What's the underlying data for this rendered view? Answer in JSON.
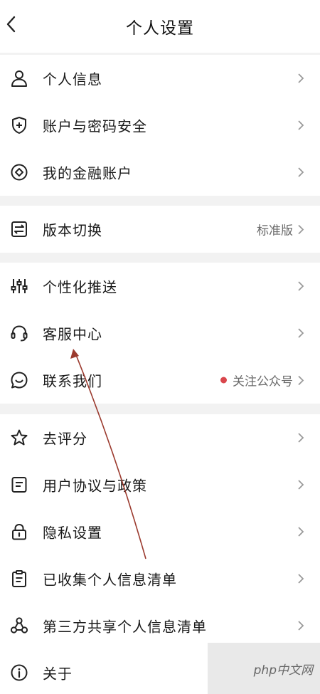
{
  "header": {
    "title": "个人设置",
    "back_icon": "chevron-left-icon"
  },
  "groups": [
    {
      "items": [
        {
          "label": "个人信息",
          "icon": "user-icon"
        },
        {
          "label": "账户与密码安全",
          "icon": "shield-plus-icon"
        },
        {
          "label": "我的金融账户",
          "icon": "diamond-circle-icon"
        }
      ]
    },
    {
      "items": [
        {
          "label": "版本切换",
          "icon": "switch-icon",
          "value": "标准版"
        }
      ]
    },
    {
      "items": [
        {
          "label": "个性化推送",
          "icon": "sliders-icon"
        },
        {
          "label": "客服中心",
          "icon": "headset-icon"
        },
        {
          "label": "联系我们",
          "icon": "chat-icon",
          "value": "关注公众号",
          "value_dot_color": "#d9464c"
        }
      ]
    },
    {
      "items": [
        {
          "label": "去评分",
          "icon": "star-icon"
        },
        {
          "label": "用户协议与政策",
          "icon": "document-icon"
        },
        {
          "label": "隐私设置",
          "icon": "lock-icon"
        },
        {
          "label": "已收集个人信息清单",
          "icon": "clipboard-list-icon"
        },
        {
          "label": "第三方共享个人信息清单",
          "icon": "share-nodes-icon"
        },
        {
          "label": "关于",
          "icon": "info-icon"
        }
      ]
    }
  ],
  "watermark": "php中文网",
  "colors": {
    "background": "#f2f2f2",
    "surface": "#ffffff",
    "annotation_arrow": "#9b3a2e",
    "badge_dot": "#d9464c"
  }
}
